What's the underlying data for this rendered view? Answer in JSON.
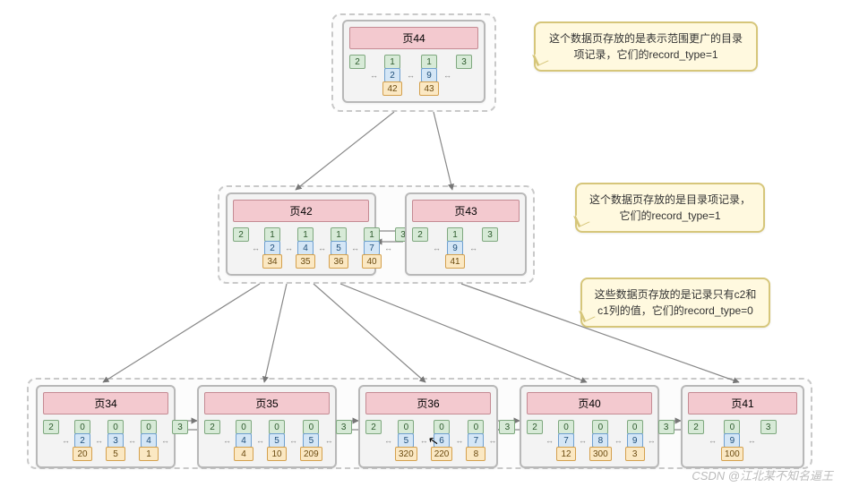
{
  "watermark": "CSDN @江北某不知名逼王",
  "callouts": {
    "top": "这个数据页存放的是表示范围更广的目录项记录，它们的record_type=1",
    "mid": "这个数据页存放的是目录项记录，它们的record_type=1",
    "bottom": "这些数据页存放的是记录只有c2和c1列的值，它们的record_type=0"
  },
  "pages": {
    "p44": {
      "title": "页44",
      "infimum": "2",
      "supremum": "3",
      "records": [
        {
          "t": "1",
          "k": "2",
          "p": "42"
        },
        {
          "t": "1",
          "k": "9",
          "p": "43"
        }
      ]
    },
    "p42": {
      "title": "页42",
      "infimum": "2",
      "supremum": "3",
      "records": [
        {
          "t": "1",
          "k": "2",
          "p": "34"
        },
        {
          "t": "1",
          "k": "4",
          "p": "35"
        },
        {
          "t": "1",
          "k": "5",
          "p": "36"
        },
        {
          "t": "1",
          "k": "7",
          "p": "40"
        }
      ]
    },
    "p43": {
      "title": "页43",
      "infimum": "2",
      "supremum": "3",
      "records": [
        {
          "t": "1",
          "k": "9",
          "p": "41"
        }
      ]
    },
    "p34": {
      "title": "页34",
      "infimum": "2",
      "supremum": "3",
      "records": [
        {
          "t": "0",
          "k": "2",
          "p": "20"
        },
        {
          "t": "0",
          "k": "3",
          "p": "5"
        },
        {
          "t": "0",
          "k": "4",
          "p": "1"
        }
      ]
    },
    "p35": {
      "title": "页35",
      "infimum": "2",
      "supremum": "3",
      "records": [
        {
          "t": "0",
          "k": "4",
          "p": "4"
        },
        {
          "t": "0",
          "k": "5",
          "p": "10"
        },
        {
          "t": "0",
          "k": "5",
          "p": "209"
        }
      ]
    },
    "p36": {
      "title": "页36",
      "infimum": "2",
      "supremum": "3",
      "records": [
        {
          "t": "0",
          "k": "5",
          "p": "320"
        },
        {
          "t": "0",
          "k": "6",
          "p": "220"
        },
        {
          "t": "0",
          "k": "7",
          "p": "8"
        }
      ]
    },
    "p40": {
      "title": "页40",
      "infimum": "2",
      "supremum": "3",
      "records": [
        {
          "t": "0",
          "k": "7",
          "p": "12"
        },
        {
          "t": "0",
          "k": "8",
          "p": "300"
        },
        {
          "t": "0",
          "k": "9",
          "p": "3"
        }
      ]
    },
    "p41": {
      "title": "页41",
      "infimum": "2",
      "supremum": "3",
      "records": [
        {
          "t": "0",
          "k": "9",
          "p": "100"
        }
      ]
    }
  },
  "chart_data": {
    "type": "tree-diagram",
    "description": "B+Tree secondary index structure with 3 levels",
    "root": "页44",
    "edges_tree": [
      [
        "页44",
        "页42"
      ],
      [
        "页44",
        "页43"
      ],
      [
        "页42",
        "页34"
      ],
      [
        "页42",
        "页35"
      ],
      [
        "页42",
        "页36"
      ],
      [
        "页42",
        "页40"
      ],
      [
        "页43",
        "页41"
      ]
    ],
    "sibling_links": [
      [
        "页42",
        "页43"
      ],
      [
        "页34",
        "页35"
      ],
      [
        "页35",
        "页36"
      ],
      [
        "页36",
        "页40"
      ],
      [
        "页40",
        "页41"
      ]
    ],
    "record_layout": [
      "record_type",
      "key(c2)",
      "pointer_or_c1"
    ],
    "pages": {
      "页44": {
        "level": 2,
        "record_type": 1,
        "entries": [
          {
            "key": 2,
            "ptr": 42
          },
          {
            "key": 9,
            "ptr": 43
          }
        ]
      },
      "页42": {
        "level": 1,
        "record_type": 1,
        "entries": [
          {
            "key": 2,
            "ptr": 34
          },
          {
            "key": 4,
            "ptr": 35
          },
          {
            "key": 5,
            "ptr": 36
          },
          {
            "key": 7,
            "ptr": 40
          }
        ]
      },
      "页43": {
        "level": 1,
        "record_type": 1,
        "entries": [
          {
            "key": 9,
            "ptr": 41
          }
        ]
      },
      "页34": {
        "level": 0,
        "record_type": 0,
        "entries": [
          {
            "c2": 2,
            "c1": 20
          },
          {
            "c2": 3,
            "c1": 5
          },
          {
            "c2": 4,
            "c1": 1
          }
        ]
      },
      "页35": {
        "level": 0,
        "record_type": 0,
        "entries": [
          {
            "c2": 4,
            "c1": 4
          },
          {
            "c2": 5,
            "c1": 10
          },
          {
            "c2": 5,
            "c1": 209
          }
        ]
      },
      "页36": {
        "level": 0,
        "record_type": 0,
        "entries": [
          {
            "c2": 5,
            "c1": 320
          },
          {
            "c2": 6,
            "c1": 220
          },
          {
            "c2": 7,
            "c1": 8
          }
        ]
      },
      "页40": {
        "level": 0,
        "record_type": 0,
        "entries": [
          {
            "c2": 7,
            "c1": 12
          },
          {
            "c2": 8,
            "c1": 300
          },
          {
            "c2": 9,
            "c1": 3
          }
        ]
      },
      "页41": {
        "level": 0,
        "record_type": 0,
        "entries": [
          {
            "c2": 9,
            "c1": 100
          }
        ]
      }
    }
  }
}
